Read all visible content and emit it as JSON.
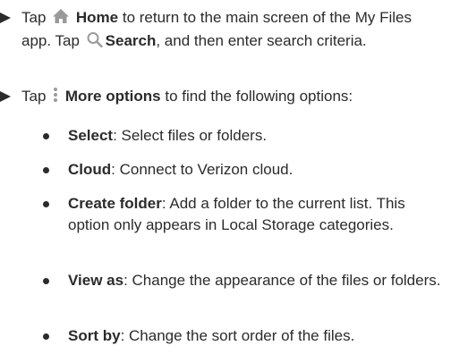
{
  "home_para": {
    "tap1": "Tap",
    "home_icon": "home-icon",
    "home_label": "Home",
    "text1": "to return to the main screen of the My Files app. Tap",
    "search_icon": "search-icon",
    "search_label": "Search",
    "text2": ", and then enter search criteria."
  },
  "more_para": {
    "tap": "Tap",
    "more_icon": "more-options-icon",
    "more_label": "More options",
    "text": "to find the following options:"
  },
  "options": [
    {
      "label": "Select",
      "desc": ": Select files or folders."
    },
    {
      "label": "Cloud",
      "desc": ": Connect to Verizon cloud."
    },
    {
      "label": "Create folder",
      "desc": ": Add a folder to the current list. This option only appears in Local Storage categories."
    },
    {
      "label": "View as",
      "desc": ": Change the appearance of the files or folders."
    },
    {
      "label": "Sort by",
      "desc": ": Change the sort order of the files."
    }
  ],
  "colors": {
    "text": "#2b2b2b",
    "icon": "#9a9a9a"
  }
}
